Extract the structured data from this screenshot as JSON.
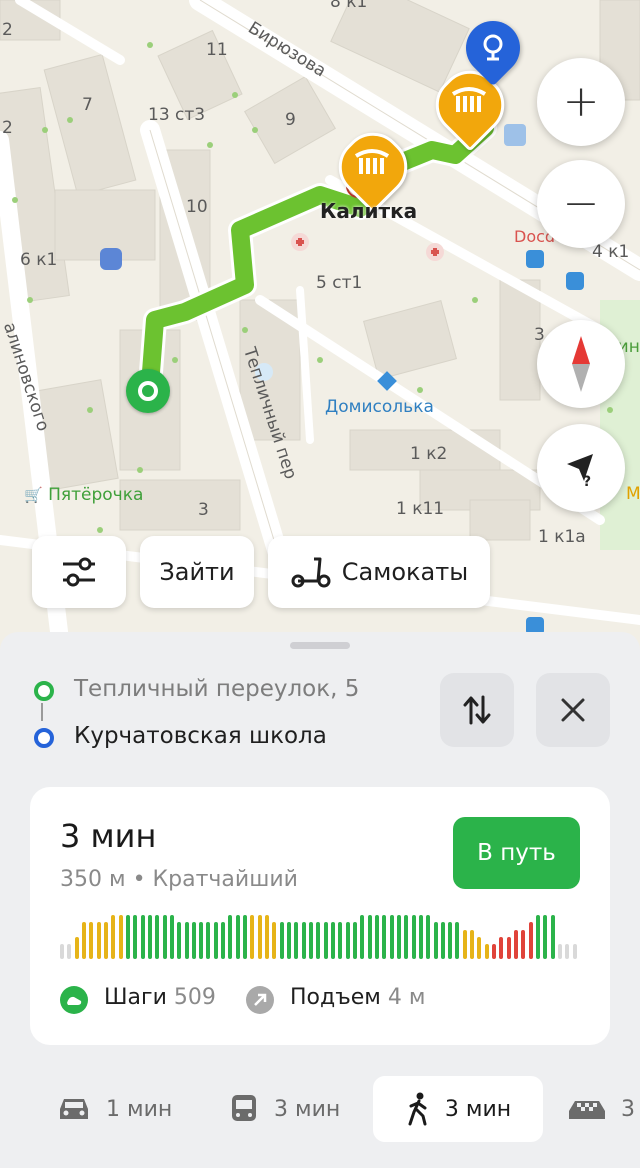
{
  "map": {
    "labels": {
      "biryuzova": "Бирюзова",
      "n8k1": "8 к1",
      "n2a": "2",
      "n2b": "2",
      "n11": "11",
      "n7": "7",
      "n13st3": "13 ст3",
      "n9": "9",
      "n10": "10",
      "n6k1": "6 к1",
      "n5st1": "5 ст1",
      "teplichny": "Тепличный пер",
      "malinovskogo": "алиновского",
      "pyaterochka": "Пятёрочка",
      "n3a": "3",
      "n3b": "3",
      "kalitka": "Калитка",
      "docdeti": "Docdeti",
      "n4k1": "4 к1",
      "vin": "Вин",
      "domisolka": "Домисолька",
      "n1k2": "1 к2",
      "n1k11": "1 к11",
      "n1k1a": "1 к1а",
      "m": "М"
    },
    "route_color": "#6cc230",
    "zoom_in": "+",
    "zoom_out": "−"
  },
  "chips": {
    "enter": "Зайти",
    "scooters": "Самокаты"
  },
  "route": {
    "from": "Тепличный переулок, 5",
    "to": "Курчатовская школа",
    "duration": "3 мин",
    "details": "350 м • Кратчайший",
    "go_button": "В путь",
    "steps_label": "Шаги",
    "steps_value": "509",
    "ascent_label": "Подъем",
    "ascent_value": "4 м",
    "elevation_profile": [
      2,
      2,
      3,
      5,
      5,
      5,
      5,
      6,
      6,
      6,
      6,
      6,
      6,
      6,
      6,
      6,
      5,
      5,
      5,
      5,
      5,
      5,
      5,
      6,
      6,
      6,
      6,
      6,
      6,
      5,
      5,
      5,
      5,
      5,
      5,
      5,
      5,
      5,
      5,
      5,
      5,
      6,
      6,
      6,
      6,
      6,
      6,
      6,
      6,
      6,
      6,
      5,
      5,
      5,
      5,
      4,
      4,
      3,
      2,
      2,
      3,
      3,
      4,
      4,
      5,
      6,
      6,
      6,
      2,
      2,
      2
    ],
    "colors": {
      "green": "#2bb34a",
      "yellow": "#e6b418",
      "red": "#e0433a",
      "gray": "#d9d9d9"
    }
  },
  "modes": {
    "car": "1 мин",
    "bus": "3 мин",
    "walk": "3 мин",
    "taxi": "3"
  },
  "colors": {
    "accent_green": "#2bb34a",
    "pin_blue": "#2563d9",
    "poi_orange": "#f2a70c"
  }
}
